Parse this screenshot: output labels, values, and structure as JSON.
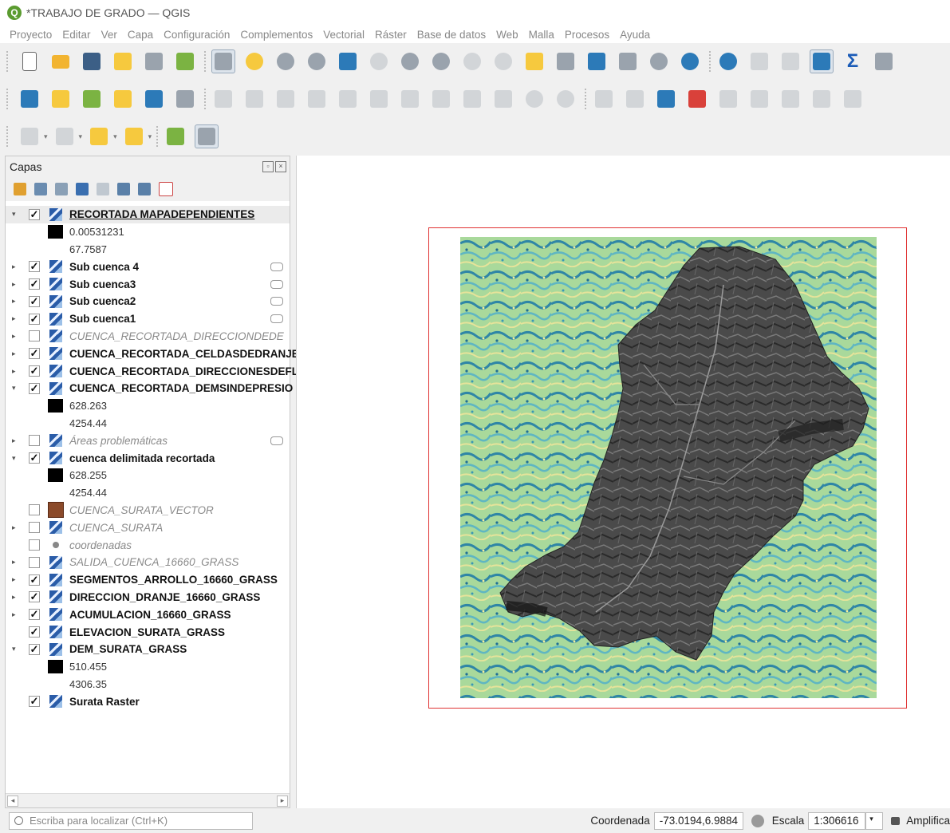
{
  "window": {
    "title": "*TRABAJO DE GRADO — QGIS"
  },
  "menu": [
    "Proyecto",
    "Editar",
    "Ver",
    "Capa",
    "Configuración",
    "Complementos",
    "Vectorial",
    "Ráster",
    "Base de datos",
    "Web",
    "Malla",
    "Procesos",
    "Ayuda"
  ],
  "layers_panel": {
    "title": "Capas",
    "rows": [
      {
        "kind": "layer",
        "arrow": "▾",
        "checked": true,
        "icon": "raster",
        "name": "RECORTADA MAPADEPENDIENTES",
        "state": "on",
        "underline": true,
        "selected": true
      },
      {
        "kind": "legend",
        "swatch": true,
        "value": "0.00531231"
      },
      {
        "kind": "legend",
        "swatch": false,
        "value": "67.7587"
      },
      {
        "kind": "layer",
        "arrow": "▸",
        "checked": true,
        "icon": "raster",
        "name": "Sub cuenca 4",
        "state": "on",
        "filter": true
      },
      {
        "kind": "layer",
        "arrow": "▸",
        "checked": true,
        "icon": "raster",
        "name": "Sub cuenca3",
        "state": "on",
        "filter": true
      },
      {
        "kind": "layer",
        "arrow": "▸",
        "checked": true,
        "icon": "raster",
        "name": "Sub cuenca2",
        "state": "on",
        "filter": true
      },
      {
        "kind": "layer",
        "arrow": "▸",
        "checked": true,
        "icon": "raster",
        "name": "Sub cuenca1",
        "state": "on",
        "filter": true
      },
      {
        "kind": "layer",
        "arrow": "▸",
        "checked": false,
        "icon": "raster",
        "name": "CUENCA_RECORTADA_DIRECCIONDEDE",
        "state": "off"
      },
      {
        "kind": "layer",
        "arrow": "▸",
        "checked": true,
        "icon": "raster",
        "name": "CUENCA_RECORTADA_CELDASDEDRANJE",
        "state": "on"
      },
      {
        "kind": "layer",
        "arrow": "▸",
        "checked": true,
        "icon": "raster",
        "name": "CUENCA_RECORTADA_DIRECCIONESDEFL",
        "state": "on"
      },
      {
        "kind": "layer",
        "arrow": "▾",
        "checked": true,
        "icon": "raster",
        "name": "CUENCA_RECORTADA_DEMSINDEPRESIO",
        "state": "on"
      },
      {
        "kind": "legend",
        "swatch": true,
        "value": "628.263"
      },
      {
        "kind": "legend",
        "swatch": false,
        "value": "4254.44"
      },
      {
        "kind": "layer",
        "arrow": "▸",
        "checked": false,
        "icon": "raster",
        "name": "Áreas problemáticas",
        "state": "off",
        "filter": true
      },
      {
        "kind": "layer",
        "arrow": "▾",
        "checked": true,
        "icon": "raster",
        "name": "cuenca delimitada recortada",
        "state": "on"
      },
      {
        "kind": "legend",
        "swatch": true,
        "value": "628.255"
      },
      {
        "kind": "legend",
        "swatch": false,
        "value": "4254.44"
      },
      {
        "kind": "layer",
        "arrow": "",
        "checked": false,
        "icon": "poly",
        "name": "CUENCA_SURATA_VECTOR",
        "state": "off"
      },
      {
        "kind": "layer",
        "arrow": "▸",
        "checked": false,
        "icon": "raster",
        "name": "CUENCA_SURATA",
        "state": "off"
      },
      {
        "kind": "layer",
        "arrow": "",
        "checked": false,
        "icon": "point",
        "name": "coordenadas",
        "state": "off"
      },
      {
        "kind": "layer",
        "arrow": "▸",
        "checked": false,
        "icon": "raster",
        "name": "SALIDA_CUENCA_16660_GRASS",
        "state": "off"
      },
      {
        "kind": "layer",
        "arrow": "▸",
        "checked": true,
        "icon": "raster",
        "name": "SEGMENTOS_ARROLLO_16660_GRASS",
        "state": "on"
      },
      {
        "kind": "layer",
        "arrow": "▸",
        "checked": true,
        "icon": "raster",
        "name": "DIRECCION_DRANJE_16660_GRASS",
        "state": "on"
      },
      {
        "kind": "layer",
        "arrow": "▸",
        "checked": true,
        "icon": "raster",
        "name": "ACUMULACION_16660_GRASS",
        "state": "on"
      },
      {
        "kind": "layer",
        "arrow": "",
        "checked": true,
        "icon": "raster",
        "name": "ELEVACION_SURATA_GRASS",
        "state": "on"
      },
      {
        "kind": "layer",
        "arrow": "▾",
        "checked": true,
        "icon": "raster",
        "name": "DEM_SURATA_GRASS",
        "state": "on"
      },
      {
        "kind": "legend",
        "swatch": true,
        "value": "510.455"
      },
      {
        "kind": "legend",
        "swatch": false,
        "value": "4306.35"
      },
      {
        "kind": "layer",
        "arrow": "",
        "checked": true,
        "icon": "raster",
        "name": "Surata Raster",
        "state": "on"
      }
    ]
  },
  "statusbar": {
    "search_placeholder": "Escriba para localizar (Ctrl+K)",
    "coord_label": "Coordenada",
    "coord_value": "-73.0194,6.9884",
    "scale_label": "Escala",
    "scale_value": "1:306616",
    "magnifier_label": "Amplifica"
  },
  "colors": {
    "extent_frame": "#e03333",
    "qgis_green": "#5a9b2f"
  }
}
